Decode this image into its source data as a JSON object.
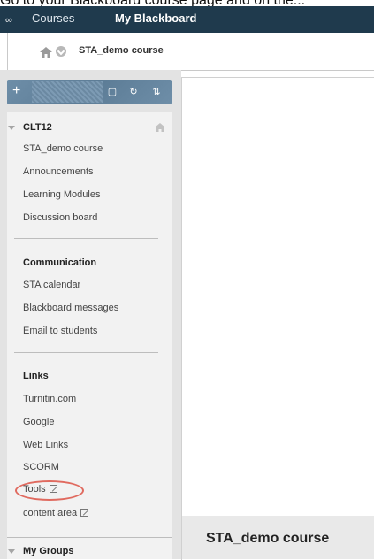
{
  "caption": "Go to your Blackboard course page and on the...",
  "topbar": {
    "tabs": [
      "Courses",
      "My Blackboard"
    ]
  },
  "breadcrumb": {
    "course": "STA_demo course"
  },
  "menu": {
    "course_section": "CLT12",
    "course_items": [
      "STA_demo course",
      "Announcements",
      "Learning Modules",
      "Discussion board"
    ],
    "communication_header": "Communication",
    "communication_items": [
      "STA calendar",
      "Blackboard messages",
      "Email to students"
    ],
    "links_header": "Links",
    "links_items": [
      "Turnitin.com",
      "Google",
      "Web Links",
      "SCORM"
    ],
    "tools_label": "Tools",
    "content_area_label": "content area",
    "groups_header": "My Groups"
  },
  "content": {
    "title": "STA_demo course"
  },
  "colors": {
    "topbar": "#1f3a4d",
    "toolbar": "#6e8ea8",
    "highlight": "#e06a5f"
  }
}
